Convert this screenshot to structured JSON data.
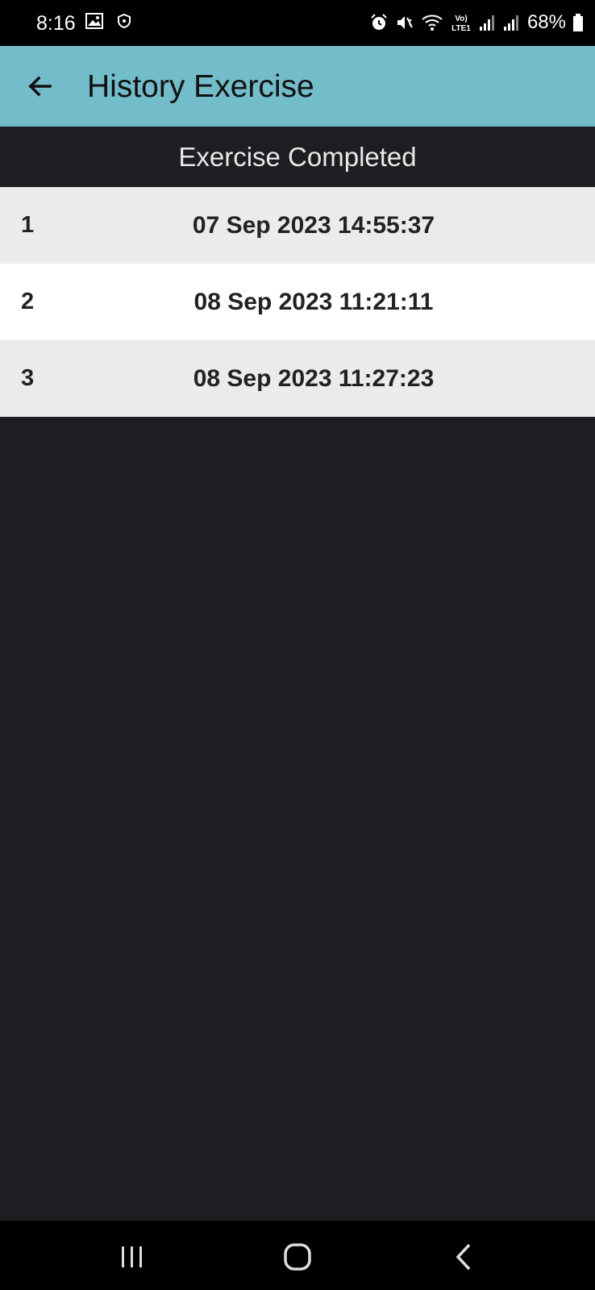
{
  "status_bar": {
    "time": "8:16",
    "battery": "68%",
    "left_icons": [
      "gallery-icon",
      "shield-icon"
    ],
    "right_icons": [
      "alarm-icon",
      "mute-icon",
      "wifi-icon",
      "volte-icon",
      "signal-icon",
      "signal-icon",
      "battery-icon"
    ]
  },
  "app_bar": {
    "title": "History Exercise",
    "back_icon": "arrow-left-icon",
    "background": "#73bcca"
  },
  "section": {
    "header": "Exercise Completed"
  },
  "history": [
    {
      "index": "1",
      "datetime": "07 Sep 2023 14:55:37"
    },
    {
      "index": "2",
      "datetime": "08 Sep 2023 11:21:11"
    },
    {
      "index": "3",
      "datetime": "08 Sep 2023 11:27:23"
    }
  ],
  "nav_bar": {
    "icons": [
      "recent-apps-icon",
      "home-icon",
      "back-icon"
    ]
  },
  "colors": {
    "background": "#1e1d22",
    "row_odd": "#ebebeb",
    "row_even": "#ffffff"
  }
}
